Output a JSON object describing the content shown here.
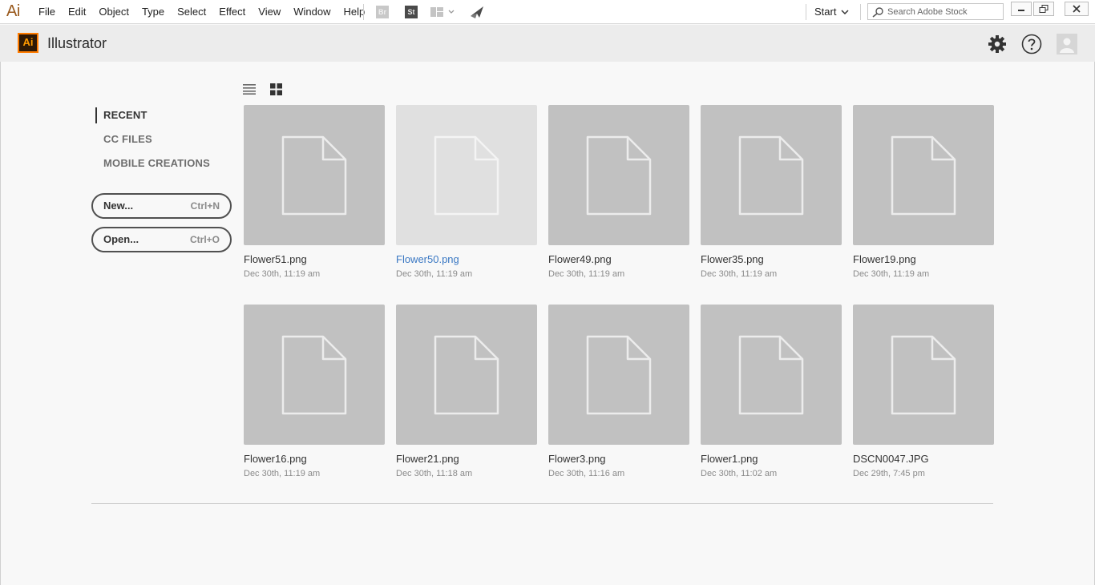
{
  "menubar": {
    "app_logo": "Ai",
    "menus": [
      "File",
      "Edit",
      "Object",
      "Type",
      "Select",
      "Effect",
      "View",
      "Window",
      "Help"
    ],
    "bridge_label": "Br",
    "stock_label": "St",
    "workspace_label": "Start",
    "search_placeholder": "Search Adobe Stock"
  },
  "header": {
    "badge": "Ai",
    "title": "Illustrator"
  },
  "sidebar": {
    "items": [
      {
        "label": "RECENT",
        "active": true
      },
      {
        "label": "CC FILES",
        "active": false
      },
      {
        "label": "MOBILE CREATIONS",
        "active": false
      }
    ],
    "new_button": {
      "label": "New...",
      "shortcut": "Ctrl+N"
    },
    "open_button": {
      "label": "Open...",
      "shortcut": "Ctrl+O"
    }
  },
  "files": [
    {
      "name": "Flower51.png",
      "date": "Dec 30th, 11:19 am"
    },
    {
      "name": "Flower50.png",
      "date": "Dec 30th, 11:19 am"
    },
    {
      "name": "Flower49.png",
      "date": "Dec 30th, 11:19 am"
    },
    {
      "name": "Flower35.png",
      "date": "Dec 30th, 11:19 am"
    },
    {
      "name": "Flower19.png",
      "date": "Dec 30th, 11:19 am"
    },
    {
      "name": "Flower16.png",
      "date": "Dec 30th, 11:19 am"
    },
    {
      "name": "Flower21.png",
      "date": "Dec 30th, 11:18 am"
    },
    {
      "name": "Flower3.png",
      "date": "Dec 30th, 11:16 am"
    },
    {
      "name": "Flower1.png",
      "date": "Dec 30th, 11:02 am"
    },
    {
      "name": "DSCN0047.JPG",
      "date": "Dec 29th, 7:45 pm"
    }
  ],
  "colors": {
    "accent_link": "#3a78c3",
    "thumb_bg": "#c1c1c1",
    "thumb_hover_bg": "#e0e0e0",
    "ai_badge_border": "#ff7c00"
  }
}
